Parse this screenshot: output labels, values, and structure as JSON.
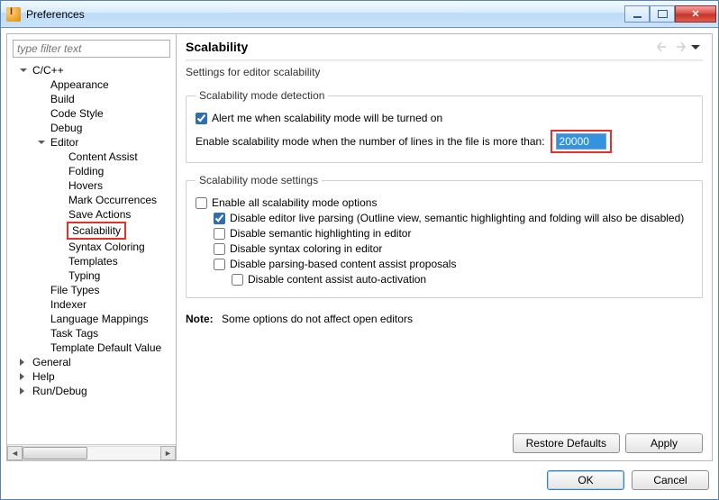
{
  "window": {
    "title": "Preferences"
  },
  "filter": {
    "placeholder": "type filter text"
  },
  "tree": {
    "items": [
      {
        "label": "C/C++",
        "lvl": 0,
        "exp": "open"
      },
      {
        "label": "Appearance",
        "lvl": 1
      },
      {
        "label": "Build",
        "lvl": 1
      },
      {
        "label": "Code Style",
        "lvl": 1
      },
      {
        "label": "Debug",
        "lvl": 1
      },
      {
        "label": "Editor",
        "lvl": 1,
        "exp": "open"
      },
      {
        "label": "Content Assist",
        "lvl": 2
      },
      {
        "label": "Folding",
        "lvl": 2
      },
      {
        "label": "Hovers",
        "lvl": 2
      },
      {
        "label": "Mark Occurrences",
        "lvl": 2
      },
      {
        "label": "Save Actions",
        "lvl": 2
      },
      {
        "label": "Scalability",
        "lvl": 2,
        "selected": true
      },
      {
        "label": "Syntax Coloring",
        "lvl": 2
      },
      {
        "label": "Templates",
        "lvl": 2
      },
      {
        "label": "Typing",
        "lvl": 2
      },
      {
        "label": "File Types",
        "lvl": 1
      },
      {
        "label": "Indexer",
        "lvl": 1
      },
      {
        "label": "Language Mappings",
        "lvl": 1
      },
      {
        "label": "Task Tags",
        "lvl": 1
      },
      {
        "label": "Template Default Value",
        "lvl": 1
      },
      {
        "label": "General",
        "lvl": 0,
        "exp": "closed"
      },
      {
        "label": "Help",
        "lvl": 0,
        "exp": "closed"
      },
      {
        "label": "Run/Debug",
        "lvl": 0,
        "exp": "closed"
      }
    ]
  },
  "page": {
    "title": "Scalability",
    "subtitle": "Settings for editor scalability",
    "detection": {
      "legend": "Scalability mode detection",
      "alert_label": "Alert me when scalability mode will be turned on",
      "threshold_label": "Enable scalability mode when the number of lines in the file is more than:",
      "threshold_value": "20000"
    },
    "settings": {
      "legend": "Scalability mode settings",
      "enable_all": "Enable all scalability mode options",
      "disable_live": "Disable editor live parsing (Outline view, semantic highlighting and folding will also be disabled)",
      "disable_sem": "Disable semantic highlighting in editor",
      "disable_syntax": "Disable syntax coloring in editor",
      "disable_parsing": "Disable parsing-based content assist proposals",
      "disable_autoact": "Disable content assist auto-activation"
    },
    "note_prefix": "Note:",
    "note_text": "Some options do not affect open editors",
    "restore": "Restore Defaults",
    "apply": "Apply"
  },
  "dialog": {
    "ok": "OK",
    "cancel": "Cancel"
  }
}
